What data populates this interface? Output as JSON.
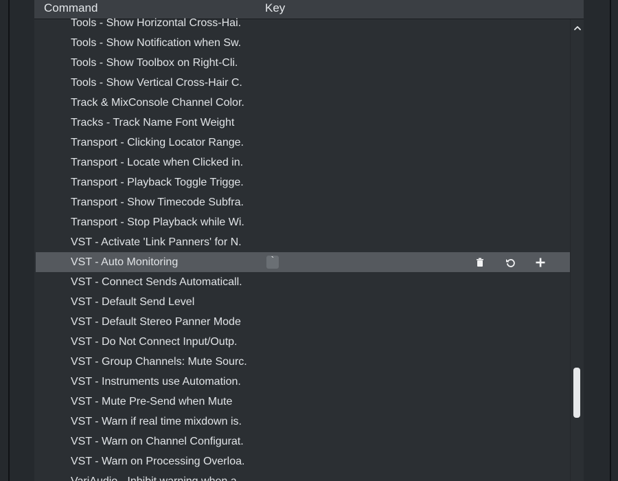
{
  "header": {
    "command_label": "Command",
    "key_label": "Key"
  },
  "rows": [
    "Tools - Show Horizontal Cross-Hai.",
    "Tools - Show Notification when Sw.",
    "Tools - Show Toolbox on Right-Cli.",
    "Tools - Show Vertical Cross-Hair C.",
    "Track & MixConsole Channel Color.",
    "Tracks - Track Name Font Weight",
    "Transport - Clicking Locator Range.",
    "Transport - Locate when Clicked in.",
    "Transport - Playback Toggle Trigge.",
    "Transport - Show Timecode Subfra.",
    "Transport - Stop Playback while Wi.",
    "VST - Activate 'Link Panners' for N.",
    "VST - Auto Monitoring",
    "VST - Connect Sends Automaticall.",
    "VST - Default Send Level",
    "VST - Default Stereo Panner Mode",
    "VST - Do Not Connect Input/Outp.",
    "VST - Group Channels: Mute Sourc.",
    "VST - Instruments use Automation.",
    "VST - Mute Pre-Send when Mute",
    "VST - Warn if real time mixdown is.",
    "VST - Warn on Channel Configurat.",
    "VST - Warn on Processing Overloa.",
    "VariAudio - Inhibit warning when a"
  ],
  "selected_row": {
    "index": 12,
    "key": "`"
  },
  "icons": {
    "delete": "trash-icon",
    "revert": "undo-icon",
    "add": "plus-icon",
    "scroll_up": "chevron-up-icon"
  },
  "colors": {
    "background": "#25292d",
    "panel": "#2b2f33",
    "header": "#3b3f44",
    "selected_row": "#55595e",
    "text": "#e1e4e7"
  }
}
